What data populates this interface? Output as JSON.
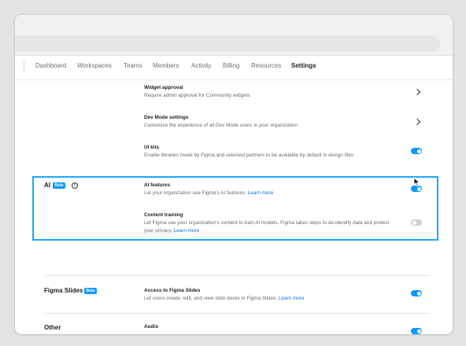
{
  "nav": {
    "tabs": [
      {
        "label": "Dashboard",
        "active": false
      },
      {
        "label": "Workspaces",
        "active": false
      },
      {
        "label": "Teams",
        "active": false
      },
      {
        "label": "Members",
        "active": false
      },
      {
        "label": "Activity",
        "active": false
      },
      {
        "label": "Billing",
        "active": false
      },
      {
        "label": "Resources",
        "active": false
      },
      {
        "label": "Settings",
        "active": true
      }
    ]
  },
  "settings": {
    "widget_approval": {
      "title": "Widget approval",
      "description": "Require admin approval for Community widgets"
    },
    "dev_mode": {
      "title": "Dev Mode settings",
      "description": "Customize the experience of all Dev Mode users in your organization"
    },
    "ui_kits": {
      "title": "UI kits",
      "description": "Enable libraries made by Figma and selected partners to be available by default in design files",
      "enabled": true
    }
  },
  "ai_section": {
    "label": "AI",
    "badge": "Beta",
    "info_icon": "info-icon",
    "ai_features": {
      "title": "AI features",
      "description": "Let your organization use Figma's AI features.",
      "link": "Learn more",
      "enabled": true
    },
    "content_training": {
      "title": "Content training",
      "description": "Let Figma use your organization's content to train AI models. Figma takes steps to de-identify data and protect your privacy.",
      "link": "Learn more",
      "enabled": false
    }
  },
  "slides_section": {
    "label": "Figma Slides",
    "badge": "Beta",
    "access": {
      "title": "Access to Figma Slides",
      "description": "Let users create, edit, and view slide decks in Figma Slides.",
      "link": "Learn more",
      "enabled": true
    }
  },
  "other_section": {
    "label": "Other",
    "audio": {
      "title": "Audio",
      "enabled": true
    }
  },
  "colors": {
    "accent": "#0d99ff",
    "highlight": "#1ea7ff",
    "link": "#0d6fd6"
  }
}
